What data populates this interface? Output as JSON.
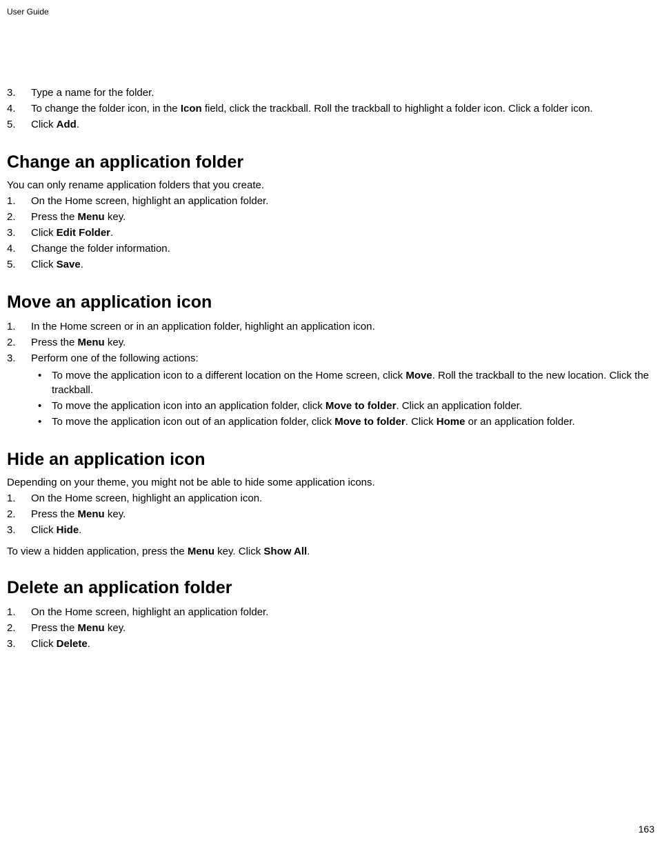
{
  "header": "User Guide",
  "page_number": "163",
  "intro_steps": {
    "s3": "Type a name for the folder.",
    "s4_pre": "To change the folder icon, in the ",
    "s4_b1": "Icon",
    "s4_post": " field, click the trackball. Roll the trackball to highlight a folder icon. Click a folder icon.",
    "s5_pre": "Click ",
    "s5_b": "Add",
    "s5_post": "."
  },
  "h1": "Change an application folder",
  "h1_intro": "You can only rename application folders that you create.",
  "h1_steps": {
    "s1": "On the Home screen, highlight an application folder.",
    "s2_pre": "Press the ",
    "s2_b": "Menu",
    "s2_post": " key.",
    "s3_pre": "Click ",
    "s3_b": "Edit Folder",
    "s3_post": ".",
    "s4": "Change the folder information.",
    "s5_pre": "Click ",
    "s5_b": "Save",
    "s5_post": "."
  },
  "h2": "Move an application icon",
  "h2_steps": {
    "s1": "In the Home screen or in an application folder, highlight an application icon.",
    "s2_pre": "Press the ",
    "s2_b": "Menu",
    "s2_post": " key.",
    "s3": "Perform one of the following actions:",
    "b1_pre": "To move the application icon to a different location on the Home screen, click ",
    "b1_b": "Move",
    "b1_post": ". Roll the trackball to the new location. Click the trackball.",
    "b2_pre": "To move the application icon into an application folder, click ",
    "b2_b": "Move to folder",
    "b2_post": ". Click an application folder.",
    "b3_pre": "To move the application icon out of an application folder, click ",
    "b3_b1": "Move to folder",
    "b3_mid": ". Click ",
    "b3_b2": "Home",
    "b3_post": " or an application folder."
  },
  "h3": "Hide an application icon",
  "h3_intro": "Depending on your theme, you might not be able to hide some application icons.",
  "h3_steps": {
    "s1": "On the Home screen, highlight an application icon.",
    "s2_pre": "Press the ",
    "s2_b": "Menu",
    "s2_post": " key.",
    "s3_pre": "Click ",
    "s3_b": "Hide",
    "s3_post": "."
  },
  "h3_outro_pre": "To view a hidden application, press the ",
  "h3_outro_b1": "Menu",
  "h3_outro_mid": " key. Click ",
  "h3_outro_b2": "Show All",
  "h3_outro_post": ".",
  "h4": "Delete an application folder",
  "h4_steps": {
    "s1": "On the Home screen, highlight an application folder.",
    "s2_pre": "Press the ",
    "s2_b": "Menu",
    "s2_post": " key.",
    "s3_pre": "Click ",
    "s3_b": "Delete",
    "s3_post": "."
  }
}
